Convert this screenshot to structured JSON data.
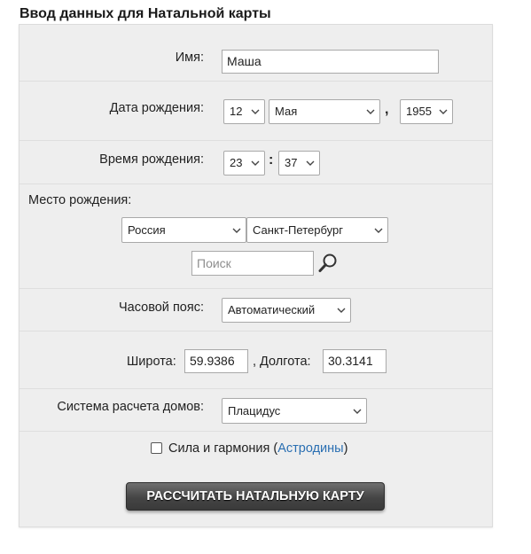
{
  "header": {
    "title": "Ввод данных для Натальной карты"
  },
  "form": {
    "name": {
      "label": "Имя:",
      "value": "Маша"
    },
    "birth_date": {
      "label": "Дата рождения:",
      "day": "12",
      "month": "Мая",
      "comma": ",",
      "year": "1955"
    },
    "birth_time": {
      "label": "Время рождения:",
      "hour": "23",
      "colon": ":",
      "minute": "37"
    },
    "birth_place": {
      "label": "Место рождения:",
      "country": "Россия",
      "city": "Санкт-Петербург",
      "search_placeholder": "Поиск",
      "search_icon": "magnifier-icon"
    },
    "timezone": {
      "label": "Часовой пояс:",
      "value": "Автоматический"
    },
    "coords": {
      "lat_label": "Широта:",
      "lat_value": "59.9386",
      "lon_label": ", Долгота:",
      "lon_value": "30.3141"
    },
    "house_system": {
      "label": "Система расчета домов:",
      "value": "Плацидус"
    },
    "strength": {
      "label": "Сила и гармония (",
      "link": "Астродины",
      "close": ")",
      "checked": false
    },
    "submit": {
      "label": "РАССЧИТАТЬ НАТАЛЬНУЮ КАРТУ"
    }
  },
  "colors": {
    "panel_bg": "#eeeeee",
    "link": "#2a6fb2",
    "button_bg": "#454545"
  }
}
